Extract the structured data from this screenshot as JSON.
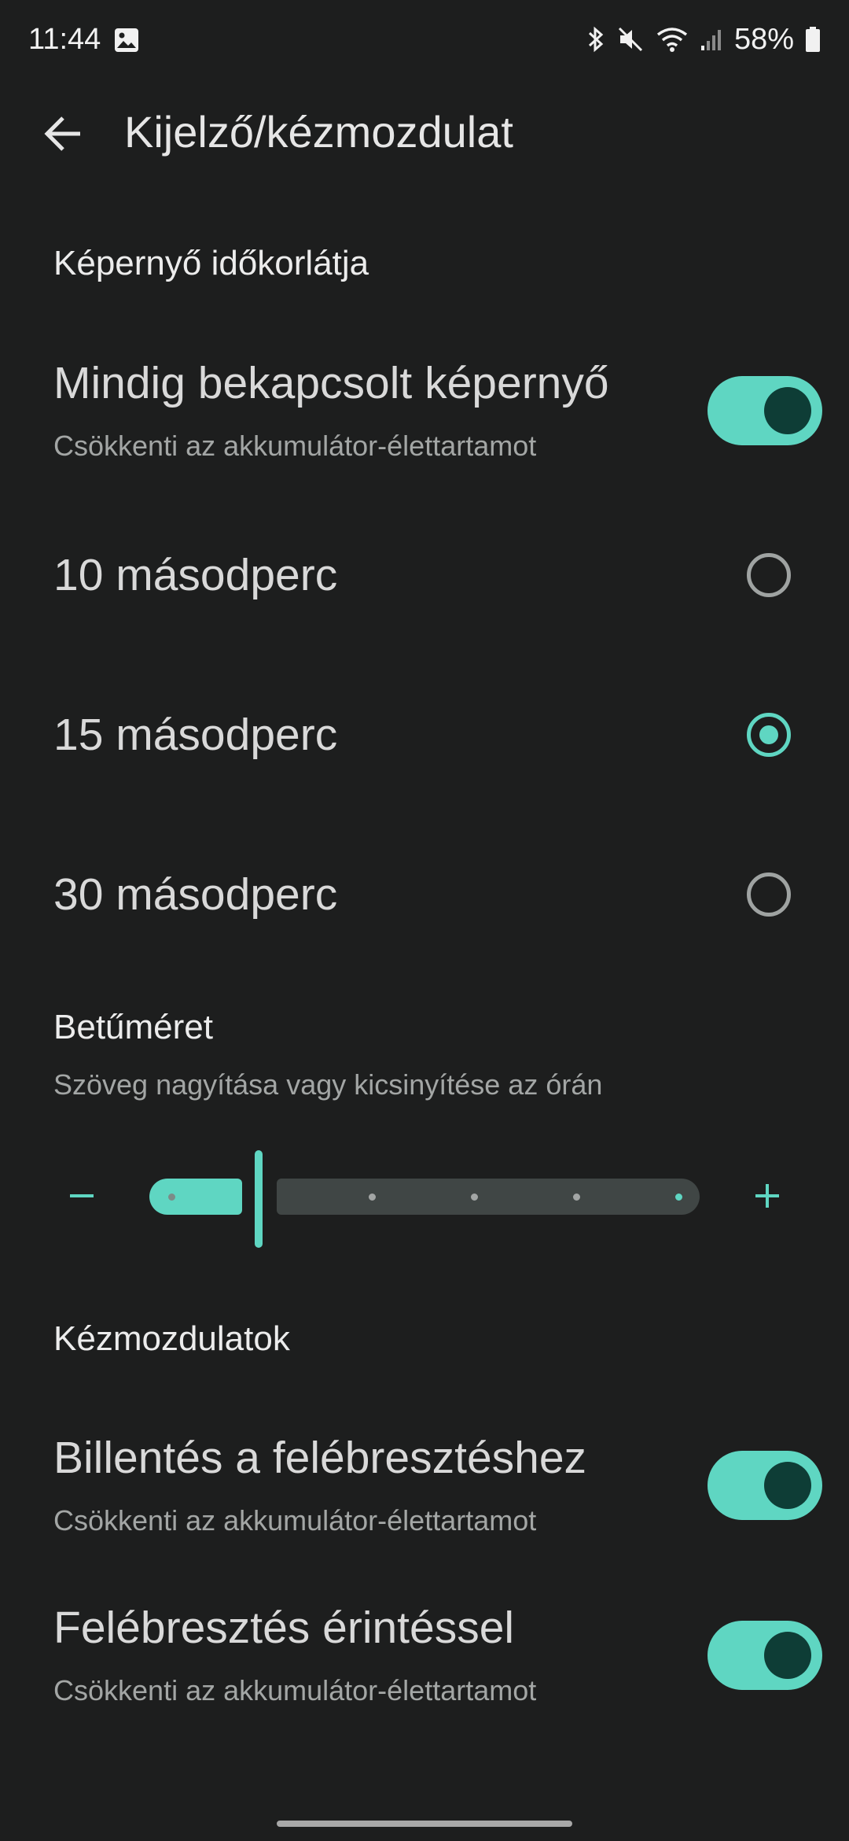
{
  "status_bar": {
    "time": "11:44",
    "battery": "58%",
    "icons": [
      "image-icon",
      "bluetooth-icon",
      "mute-icon",
      "wifi-icon",
      "signal-icon",
      "battery-icon"
    ]
  },
  "header": {
    "title": "Kijelző/kézmozdulat",
    "back_icon": "arrow-back-icon"
  },
  "screen_timeout": {
    "section_title": "Képernyő időkorlátja",
    "always_on": {
      "title": "Mindig bekapcsolt képernyő",
      "subtitle": "Csökkenti az akkumulátor-élettartamot",
      "enabled": true
    },
    "options": [
      {
        "label": "10 másodperc",
        "selected": false
      },
      {
        "label": "15 másodperc",
        "selected": true
      },
      {
        "label": "30 másodperc",
        "selected": false
      }
    ]
  },
  "font_size": {
    "title": "Betűméret",
    "subtitle": "Szöveg nagyítása vagy kicsinyítése az órán",
    "minus": "−",
    "plus": "+",
    "steps": 6,
    "current_step": 1
  },
  "gestures": {
    "section_title": "Kézmozdulatok",
    "items": [
      {
        "title": "Billentés a felébresztéshez",
        "subtitle": "Csökkenti az akkumulátor-élettartamot",
        "enabled": true
      },
      {
        "title": "Felébresztés érintéssel",
        "subtitle": "Csökkenti az akkumulátor-élettartamot",
        "enabled": true
      }
    ]
  },
  "colors": {
    "accent": "#5fd6c2",
    "background": "#1d1e1e",
    "knob": "#0e3d36"
  }
}
